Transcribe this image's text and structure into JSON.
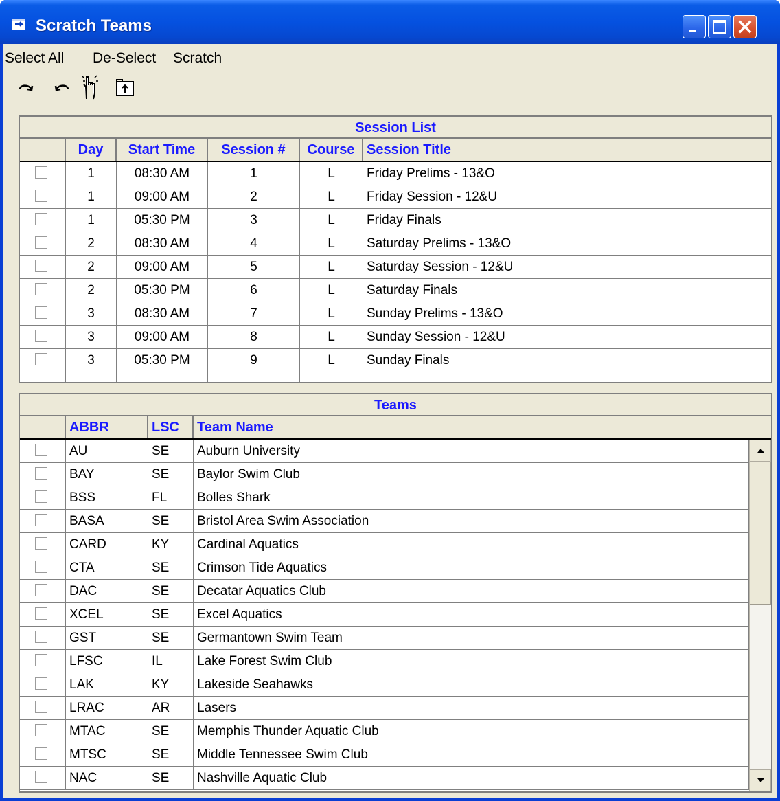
{
  "window": {
    "title": "Scratch Teams"
  },
  "menu": {
    "select_all": "Select All",
    "de_select": "De-Select",
    "scratch": "Scratch"
  },
  "toolbar": {
    "icons": [
      "redo-icon",
      "undo-icon",
      "hand-pointer-icon",
      "folder-up-icon"
    ]
  },
  "session_list": {
    "title": "Session List",
    "headers": {
      "day": "Day",
      "start_time": "Start Time",
      "session_num": "Session #",
      "course": "Course",
      "session_title": "Session Title"
    },
    "rows": [
      {
        "checked": false,
        "day": "1",
        "start_time": "08:30 AM",
        "session_num": "1",
        "course": "L",
        "session_title": "Friday Prelims - 13&O"
      },
      {
        "checked": false,
        "day": "1",
        "start_time": "09:00 AM",
        "session_num": "2",
        "course": "L",
        "session_title": "Friday Session - 12&U"
      },
      {
        "checked": false,
        "day": "1",
        "start_time": "05:30 PM",
        "session_num": "3",
        "course": "L",
        "session_title": "Friday Finals"
      },
      {
        "checked": false,
        "day": "2",
        "start_time": "08:30 AM",
        "session_num": "4",
        "course": "L",
        "session_title": "Saturday Prelims - 13&O"
      },
      {
        "checked": false,
        "day": "2",
        "start_time": "09:00 AM",
        "session_num": "5",
        "course": "L",
        "session_title": "Saturday Session - 12&U"
      },
      {
        "checked": false,
        "day": "2",
        "start_time": "05:30 PM",
        "session_num": "6",
        "course": "L",
        "session_title": "Saturday Finals"
      },
      {
        "checked": false,
        "day": "3",
        "start_time": "08:30 AM",
        "session_num": "7",
        "course": "L",
        "session_title": "Sunday Prelims - 13&O"
      },
      {
        "checked": false,
        "day": "3",
        "start_time": "09:00 AM",
        "session_num": "8",
        "course": "L",
        "session_title": "Sunday Session - 12&U"
      },
      {
        "checked": false,
        "day": "3",
        "start_time": "05:30 PM",
        "session_num": "9",
        "course": "L",
        "session_title": "Sunday Finals"
      }
    ]
  },
  "teams": {
    "title": "Teams",
    "headers": {
      "abbr": "ABBR",
      "lsc": "LSC",
      "team_name": "Team Name"
    },
    "rows": [
      {
        "checked": false,
        "abbr": "AU",
        "lsc": "SE",
        "team_name": "Auburn University"
      },
      {
        "checked": false,
        "abbr": "BAY",
        "lsc": "SE",
        "team_name": "Baylor Swim Club"
      },
      {
        "checked": false,
        "abbr": "BSS",
        "lsc": "FL",
        "team_name": "Bolles Shark"
      },
      {
        "checked": false,
        "abbr": "BASA",
        "lsc": "SE",
        "team_name": "Bristol Area Swim Association"
      },
      {
        "checked": false,
        "abbr": "CARD",
        "lsc": "KY",
        "team_name": "Cardinal Aquatics"
      },
      {
        "checked": false,
        "abbr": "CTA",
        "lsc": "SE",
        "team_name": "Crimson Tide Aquatics"
      },
      {
        "checked": false,
        "abbr": "DAC",
        "lsc": "SE",
        "team_name": "Decatar Aquatics Club"
      },
      {
        "checked": false,
        "abbr": "XCEL",
        "lsc": "SE",
        "team_name": "Excel Aquatics"
      },
      {
        "checked": false,
        "abbr": "GST",
        "lsc": "SE",
        "team_name": "Germantown Swim Team"
      },
      {
        "checked": false,
        "abbr": "LFSC",
        "lsc": "IL",
        "team_name": "Lake Forest Swim Club"
      },
      {
        "checked": false,
        "abbr": "LAK",
        "lsc": "KY",
        "team_name": "Lakeside Seahawks"
      },
      {
        "checked": false,
        "abbr": "LRAC",
        "lsc": "AR",
        "team_name": "Lasers"
      },
      {
        "checked": false,
        "abbr": "MTAC",
        "lsc": "SE",
        "team_name": "Memphis Thunder Aquatic Club"
      },
      {
        "checked": false,
        "abbr": "MTSC",
        "lsc": "SE",
        "team_name": "Middle Tennessee Swim Club"
      },
      {
        "checked": false,
        "abbr": "NAC",
        "lsc": "SE",
        "team_name": "Nashville Aquatic Club"
      }
    ]
  },
  "colors": {
    "title_bar": "#0551e0",
    "header_text": "#1a1aff",
    "face": "#ece9d8",
    "close_button": "#d7502d"
  }
}
